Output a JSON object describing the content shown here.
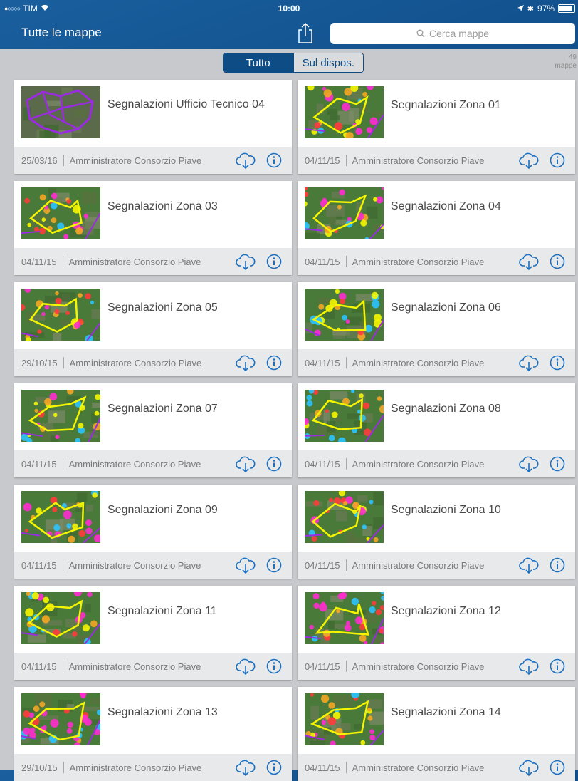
{
  "status": {
    "carrier": "TIM",
    "time": "10:00",
    "battery": "97%",
    "battery_level": 0.97
  },
  "nav": {
    "title": "Tutte le mappe",
    "search_placeholder": "Cerca mappe"
  },
  "segment": {
    "options": [
      "Tutto",
      "Sul dispos."
    ],
    "selected": "Tutto"
  },
  "count": {
    "number": "49",
    "label": "mappe"
  },
  "owner": "Amministratore Consorzio Piave",
  "maps": [
    {
      "title": "Segnalazioni Ufficio Tecnico 04",
      "date": "25/03/16",
      "thumb": "purple"
    },
    {
      "title": "Segnalazioni Zona 01",
      "date": "04/11/15",
      "thumb": "yellow"
    },
    {
      "title": "Segnalazioni Zona 03",
      "date": "04/11/15",
      "thumb": "yellow"
    },
    {
      "title": "Segnalazioni Zona 04",
      "date": "04/11/15",
      "thumb": "blue"
    },
    {
      "title": "Segnalazioni Zona 05",
      "date": "29/10/15",
      "thumb": "yellow"
    },
    {
      "title": "Segnalazioni Zona 06",
      "date": "04/11/15",
      "thumb": "yellow"
    },
    {
      "title": "Segnalazioni Zona 07",
      "date": "04/11/15",
      "thumb": "yellow"
    },
    {
      "title": "Segnalazioni Zona 08",
      "date": "04/11/15",
      "thumb": "yellow"
    },
    {
      "title": "Segnalazioni Zona 09",
      "date": "04/11/15",
      "thumb": "yellow"
    },
    {
      "title": "Segnalazioni Zona 10",
      "date": "04/11/15",
      "thumb": "blue"
    },
    {
      "title": "Segnalazioni Zona 11",
      "date": "04/11/15",
      "thumb": "yellow"
    },
    {
      "title": "Segnalazioni Zona 12",
      "date": "04/11/15",
      "thumb": "pink"
    },
    {
      "title": "Segnalazioni Zona 13",
      "date": "29/10/15",
      "thumb": "pink"
    },
    {
      "title": "Segnalazioni Zona 14",
      "date": "04/11/15",
      "thumb": "yellow"
    }
  ],
  "colors": {
    "nav_blue": "#0e4c86",
    "accent": "#1b6fc0",
    "map_green": "#4a7a3a",
    "route_yellow": "#f5f500",
    "route_purple": "#9a2be0"
  }
}
